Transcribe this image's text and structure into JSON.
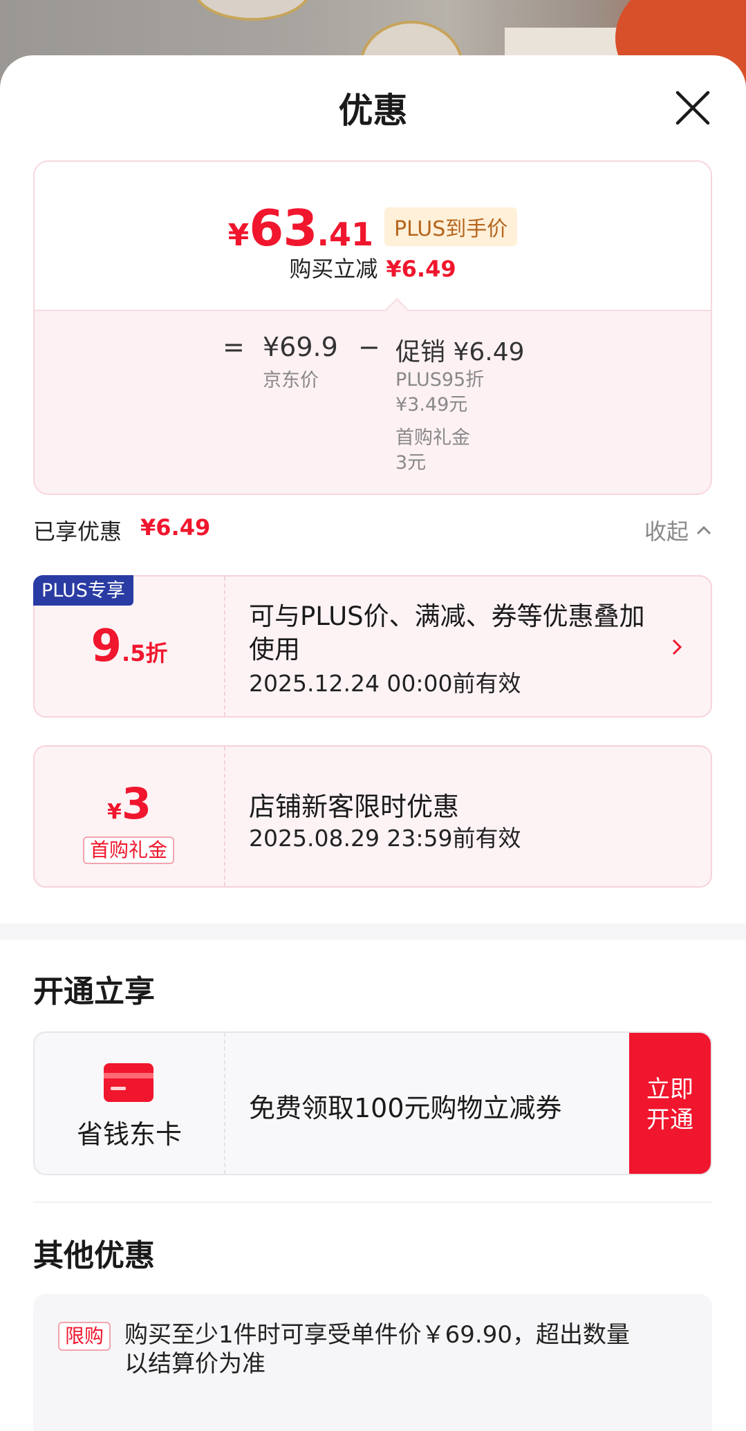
{
  "sheet": {
    "title": "优惠"
  },
  "price": {
    "currency": "¥",
    "integer": "63",
    "decimal": ".41",
    "badge": "PLUS到手价",
    "reduce_label": "购买立减",
    "reduce_amount": "¥6.49"
  },
  "breakdown": {
    "equals": "=",
    "jd_price": "¥69.9",
    "jd_label": "京东价",
    "minus": "−",
    "promo_head": "促销 ¥6.49",
    "items": [
      {
        "name": "PLUS95折",
        "amount": "¥3.49元"
      },
      {
        "name": "首购礼金",
        "amount": "3元"
      }
    ]
  },
  "enjoyed": {
    "label": "已享优惠",
    "amount": "¥6.49",
    "collapse": "收起"
  },
  "coupons": [
    {
      "corner": "PLUS专享",
      "value_big": "9",
      "value_small": ".5折",
      "title": "可与PLUS价、满减、券等优惠叠加使用",
      "date": "2025.12.24 00:00前有效"
    },
    {
      "value_currency": "¥",
      "value_big": "3",
      "tag": "首购礼金",
      "title": "店铺新客限时优惠",
      "date": "2025.08.29 23:59前有效"
    }
  ],
  "open_section": {
    "title": "开通立享",
    "card_name": "省钱东卡",
    "desc": "免费领取100元购物立减券",
    "button": "立即开通"
  },
  "other_section": {
    "title": "其他优惠",
    "tag": "限购",
    "text": "购买至少1件时可享受单件价￥69.90，超出数量以结算价为准"
  },
  "colors": {
    "accent": "#f0162d",
    "plus_blue": "#2a3ca3",
    "badge_bg": "#fff0d9"
  },
  "icons": {
    "close": "close-icon",
    "chevron": "chevron-right-icon",
    "up": "chevron-up-icon",
    "card": "card-icon"
  }
}
